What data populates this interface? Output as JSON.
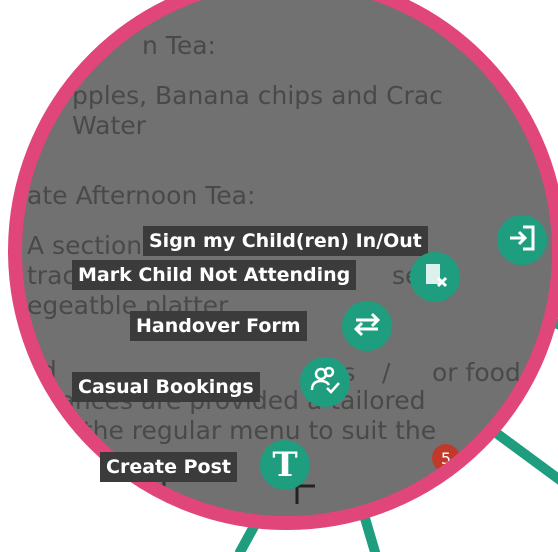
{
  "background": {
    "lines": [
      "n Tea:",
      "pples, Banana chips and Crac",
      "Water",
      "ate Afternoon Tea:",
      "A section o",
      "track",
      "egeatble platter",
      "ild",
      "lerances are provided a tailored",
      "n of the regular menu to suit the"
    ],
    "fragments": [
      "s",
      "se",
      "or food",
      "es",
      "/"
    ]
  },
  "actions": [
    {
      "label": "Sign my Child(ren) In/Out",
      "icon": "sign-in-icon"
    },
    {
      "label": "Mark Child Not Attending",
      "icon": "not-attending-icon"
    },
    {
      "label": "Handover Form",
      "icon": "swap-arrows-icon"
    },
    {
      "label": "Casual Bookings",
      "icon": "users-check-icon"
    },
    {
      "label": "Create Post",
      "icon": "text-t-icon"
    }
  ],
  "tabbar": {
    "badge_count": "5",
    "icons": [
      "calendar-icon",
      "plus-icon",
      "bell-icon"
    ]
  },
  "colors": {
    "accent": "#1e9e7e",
    "ring": "#e0467a",
    "label_bg": "#3b3b3b",
    "badge": "#c0392b"
  }
}
